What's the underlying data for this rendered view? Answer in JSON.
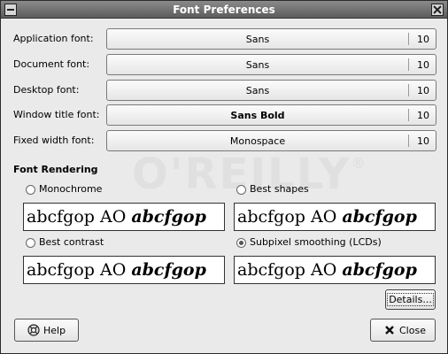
{
  "window": {
    "title": "Font Preferences"
  },
  "fonts": [
    {
      "label": "Application font:",
      "name": "Sans",
      "size": "10",
      "bold": false
    },
    {
      "label": "Document font:",
      "name": "Sans",
      "size": "10",
      "bold": false
    },
    {
      "label": "Desktop font:",
      "name": "Sans",
      "size": "10",
      "bold": false
    },
    {
      "label": "Window title font:",
      "name": "Sans Bold",
      "size": "10",
      "bold": true
    },
    {
      "label": "Fixed width font:",
      "name": "Monospace",
      "size": "10",
      "bold": false
    }
  ],
  "rendering": {
    "title": "Font Rendering",
    "options": [
      {
        "label": "Monochrome",
        "selected": false
      },
      {
        "label": "Best shapes",
        "selected": false
      },
      {
        "label": "Best contrast",
        "selected": false
      },
      {
        "label": "Subpixel smoothing (LCDs)",
        "selected": true
      }
    ],
    "sample_normal": "abcfgop AO ",
    "sample_bold": "abcfgop"
  },
  "buttons": {
    "details": "Details...",
    "help": "Help",
    "close": "Close"
  },
  "watermark": "O'REILLY"
}
